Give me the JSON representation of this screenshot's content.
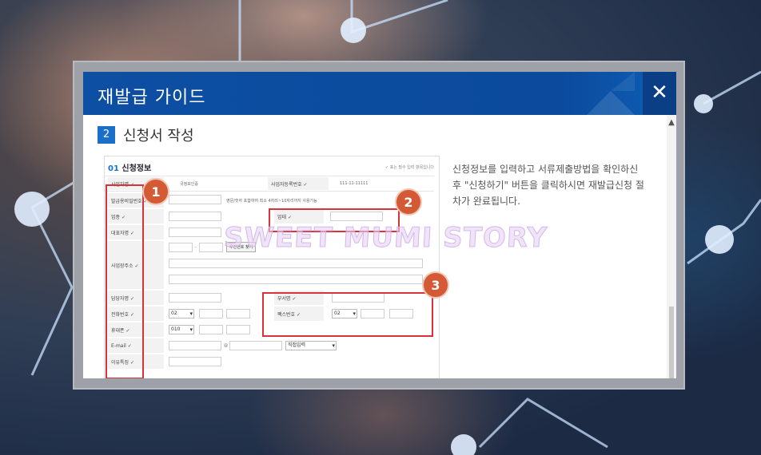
{
  "modal": {
    "title": "재발급 가이드",
    "close_glyph": "✕",
    "step_number": "2",
    "step_title": "신청서 작성",
    "description": "신청정보를 입력하고 서류제출방법을 확인하신 후 \"신청하기\" 버튼을 클릭하시면 재발급신청 절차가 완료됩니다."
  },
  "form": {
    "section_num": "01",
    "section_title": "신청정보",
    "required_note": "✓ 표는 필수 입력 항목입니다",
    "rows": {
      "company": "사업자명 ✓",
      "company_val": "국정보인증",
      "bizno": "사업자등록번호 ✓",
      "bizno_val": "111-11-11111",
      "password": "발급용비밀번호 ✓",
      "password_hint": "영문/숫자 포함하여 최소 4자리~10자리까지 사용가능",
      "industry": "업종 ✓",
      "business_type": "업태 ✓",
      "ceo": "대표자명 ✓",
      "address": "사업장주소 ✓",
      "zip_button": "우편번호 찾기",
      "manager": "담당자명 ✓",
      "department": "부서명 ✓",
      "phone": "전화번호 ✓",
      "phone_prefix": "02",
      "fax": "팩스번호 ✓",
      "fax_prefix": "02",
      "mobile": "휴대폰 ✓",
      "mobile_prefix": "010",
      "email": "E-mail ✓",
      "email_at": "@",
      "email_select": "직접입력",
      "reason": "이유특징 ✓"
    },
    "markers": [
      "1",
      "2",
      "3"
    ]
  },
  "watermark": "SWEET MUMI STORY",
  "colors": {
    "header_blue": "#0b4a9c",
    "badge_blue": "#1a6fc8",
    "highlight_red": "#d8333a",
    "marker_orange": "#d45a35"
  }
}
